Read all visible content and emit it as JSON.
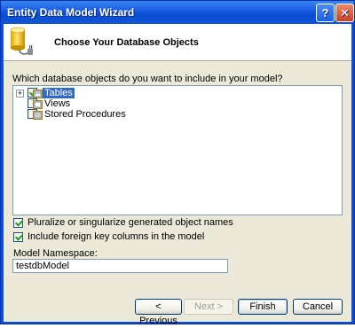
{
  "window": {
    "title": "Entity Data Model Wizard"
  },
  "titlebar": {
    "help_glyph": "?",
    "close_glyph": "✕"
  },
  "header": {
    "title": "Choose Your Database Objects"
  },
  "prompt": "Which database objects do you want to include in your model?",
  "tree": {
    "expander_glyph": "+",
    "items": [
      {
        "label": "Tables",
        "checked": true,
        "selected": true,
        "expandable": true
      },
      {
        "label": "Views",
        "checked": false,
        "selected": false,
        "expandable": false
      },
      {
        "label": "Stored Procedures",
        "checked": false,
        "selected": false,
        "expandable": false
      }
    ]
  },
  "options": [
    {
      "label": "Pluralize or singularize generated object names",
      "checked": true
    },
    {
      "label": "Include foreign key columns in the model",
      "checked": true
    }
  ],
  "namespace": {
    "label": "Model Namespace:",
    "value": "testdbModel"
  },
  "buttons": {
    "previous": "< Previous",
    "next": "Next >",
    "finish": "Finish",
    "cancel": "Cancel"
  },
  "colors": {
    "title_bar": "#0b4ccf",
    "dialog_bg": "#ece9d8",
    "selection": "#316ac5"
  }
}
